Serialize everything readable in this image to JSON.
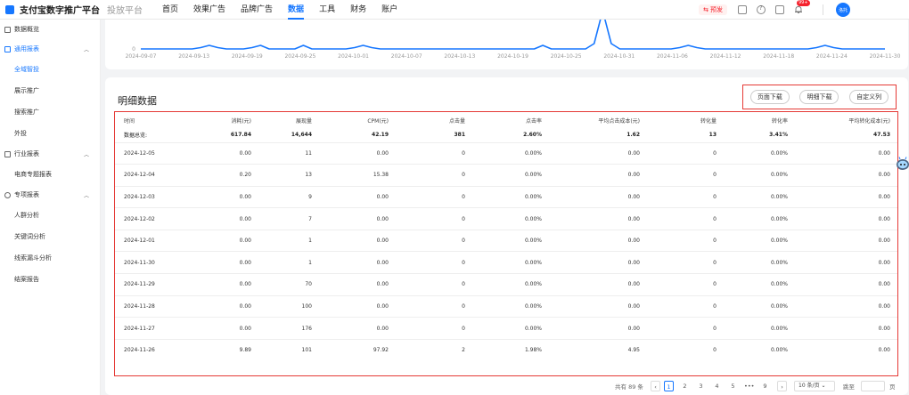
{
  "header": {
    "brand": "支付宝数字推广平台",
    "subbrand": "投放平台",
    "nav": [
      {
        "label": "首页",
        "active": false
      },
      {
        "label": "效果广告",
        "active": false
      },
      {
        "label": "品牌广告",
        "active": false
      },
      {
        "label": "数据",
        "active": true
      },
      {
        "label": "工具",
        "active": false
      },
      {
        "label": "财务",
        "active": false
      },
      {
        "label": "账户",
        "active": false
      }
    ],
    "preview_label": "预发",
    "bell_badge": "99+",
    "avatar_text": "洛托",
    "accent_color": "#1677ff"
  },
  "sidebar": {
    "sections": [
      {
        "label": "数据概览",
        "icon": "overview-icon",
        "active": false,
        "items": []
      },
      {
        "label": "通用报表",
        "icon": "report-icon",
        "active": true,
        "items": [
          {
            "label": "全域智投",
            "active": true
          },
          {
            "label": "展示推广",
            "active": false
          },
          {
            "label": "搜索推广",
            "active": false
          },
          {
            "label": "外投",
            "active": false
          }
        ]
      },
      {
        "label": "行业报表",
        "icon": "trend-icon",
        "active": false,
        "items": [
          {
            "label": "电商专题报表",
            "active": false
          }
        ]
      },
      {
        "label": "专项报表",
        "icon": "pie-icon",
        "active": false,
        "items": [
          {
            "label": "人群分析",
            "active": false
          },
          {
            "label": "关键词分析",
            "active": false
          },
          {
            "label": "线索漏斗分析",
            "active": false
          },
          {
            "label": "结案报告",
            "active": false
          }
        ]
      }
    ]
  },
  "chart_data": {
    "type": "line",
    "y_tick_visible": "0",
    "x_ticks": [
      "2024-09-07",
      "2024-09-13",
      "2024-09-19",
      "2024-09-25",
      "2024-10-01",
      "2024-10-07",
      "2024-10-13",
      "2024-10-19",
      "2024-10-25",
      "2024-10-31",
      "2024-11-06",
      "2024-11-12",
      "2024-11-18",
      "2024-11-24",
      "2024-11-30"
    ],
    "line_color": "#1677ff",
    "note": "Chart is cropped at the top; only the baseline region and the 0 tick are visible. A tall spike rises near 2024-10-31."
  },
  "detail": {
    "title": "明细数据",
    "buttons": [
      "页面下载",
      "明细下载",
      "自定义列"
    ],
    "columns": [
      "时间",
      "消耗(元)",
      "展现量",
      "CPM(元)",
      "点击量",
      "点击率",
      "平均点击成本(元)",
      "转化量",
      "转化率",
      "平均转化成本(元)"
    ],
    "summary": [
      "数据总览:",
      "617.84",
      "14,644",
      "42.19",
      "381",
      "2.60%",
      "1.62",
      "13",
      "3.41%",
      "47.53"
    ],
    "rows": [
      [
        "2024-12-05",
        "0.00",
        "11",
        "0.00",
        "0",
        "0.00%",
        "0.00",
        "0",
        "0.00%",
        "0.00"
      ],
      [
        "2024-12-04",
        "0.20",
        "13",
        "15.38",
        "0",
        "0.00%",
        "0.00",
        "0",
        "0.00%",
        "0.00"
      ],
      [
        "2024-12-03",
        "0.00",
        "9",
        "0.00",
        "0",
        "0.00%",
        "0.00",
        "0",
        "0.00%",
        "0.00"
      ],
      [
        "2024-12-02",
        "0.00",
        "7",
        "0.00",
        "0",
        "0.00%",
        "0.00",
        "0",
        "0.00%",
        "0.00"
      ],
      [
        "2024-12-01",
        "0.00",
        "1",
        "0.00",
        "0",
        "0.00%",
        "0.00",
        "0",
        "0.00%",
        "0.00"
      ],
      [
        "2024-11-30",
        "0.00",
        "1",
        "0.00",
        "0",
        "0.00%",
        "0.00",
        "0",
        "0.00%",
        "0.00"
      ],
      [
        "2024-11-29",
        "0.00",
        "70",
        "0.00",
        "0",
        "0.00%",
        "0.00",
        "0",
        "0.00%",
        "0.00"
      ],
      [
        "2024-11-28",
        "0.00",
        "100",
        "0.00",
        "0",
        "0.00%",
        "0.00",
        "0",
        "0.00%",
        "0.00"
      ],
      [
        "2024-11-27",
        "0.00",
        "176",
        "0.00",
        "0",
        "0.00%",
        "0.00",
        "0",
        "0.00%",
        "0.00"
      ],
      [
        "2024-11-26",
        "9.89",
        "101",
        "97.92",
        "2",
        "1.98%",
        "4.95",
        "0",
        "0.00%",
        "0.00"
      ]
    ]
  },
  "pagination": {
    "total": "共有 89 条",
    "pages": [
      "1",
      "2",
      "3",
      "4",
      "5",
      "•••",
      "9"
    ],
    "current": "1",
    "page_size": "10 条/页",
    "jump_label": "跳至",
    "page_unit": "页"
  }
}
